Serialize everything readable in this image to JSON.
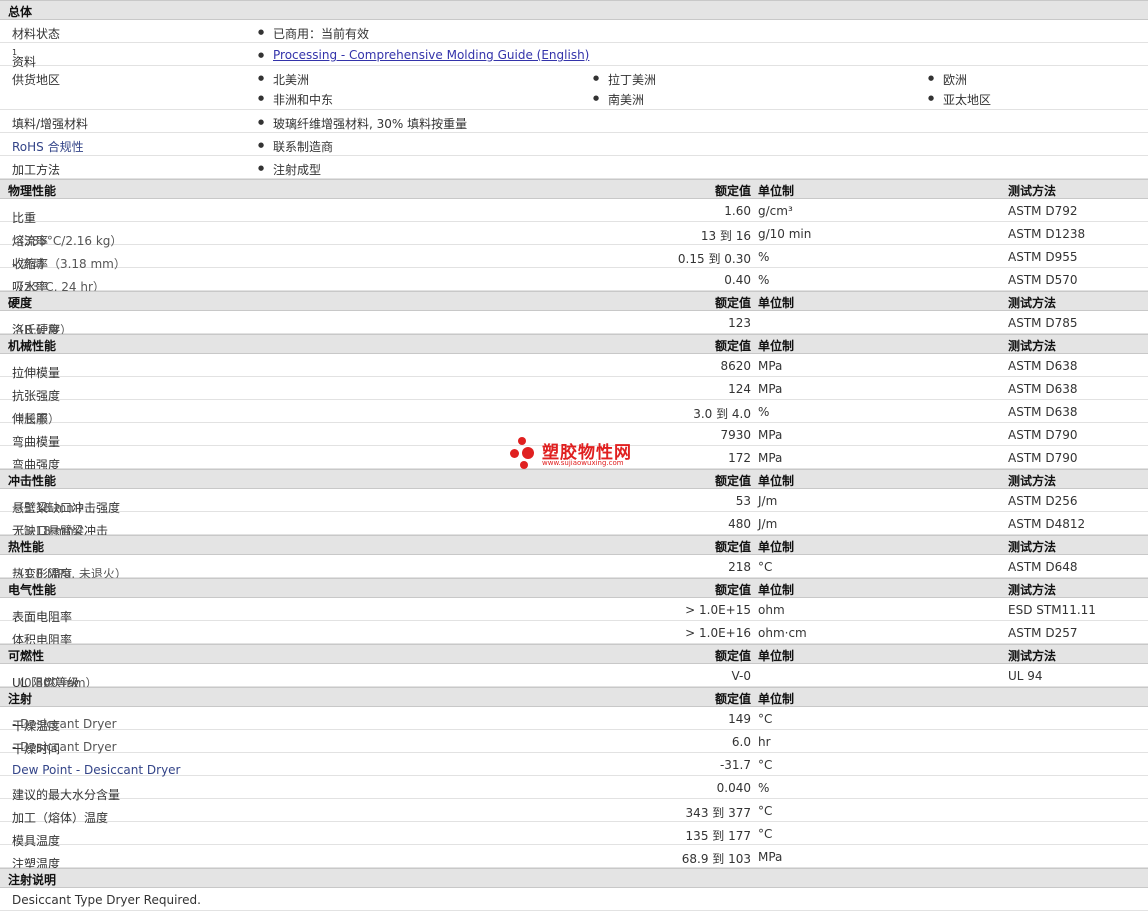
{
  "general": {
    "title": "总体",
    "status": {
      "label": "材料状态",
      "value": "已商用：当前有效"
    },
    "docs": {
      "label": "资料",
      "sup": "1",
      "link": "Processing - Comprehensive Molding Guide (English)"
    },
    "regions": {
      "label": "供货地区",
      "items": [
        "北美洲",
        "拉丁美洲",
        "欧洲",
        "非洲和中东",
        "南美洲",
        "亚太地区"
      ]
    },
    "filler": {
      "label": "填料/增强材料",
      "value": "玻璃纤维增强材料, 30% 填料按重量"
    },
    "rohs": {
      "label": "RoHS 合规性",
      "value": "联系制造商"
    },
    "process": {
      "label": "加工方法",
      "value": "注射成型"
    }
  },
  "headers": {
    "nominal": "额定值",
    "unit": "单位制",
    "method": "测试方法"
  },
  "sections": [
    {
      "title": "物理性能",
      "method_header": true,
      "rows": [
        {
          "label": "比重",
          "cond": "",
          "value": "1.60",
          "unit": "g/cm³",
          "method": "ASTM D792"
        },
        {
          "label": "熔流率",
          "cond": "（385°C/2.16 kg）",
          "value": "13 到   16",
          "unit": "g/10 min",
          "method": "ASTM D1238"
        },
        {
          "label": "收缩率",
          "cond": " - 流动 （3.18 mm）",
          "value": "0.15 到 0.30",
          "unit": "%",
          "method": "ASTM D955"
        },
        {
          "label": "吸水率",
          "cond": "（23°C, 24 hr）",
          "value": "0.40",
          "unit": "%",
          "method": "ASTM D570"
        }
      ]
    },
    {
      "title": "硬度",
      "method_header": true,
      "rows": [
        {
          "label": "洛氏硬度",
          "cond": "（R 计秤）",
          "value": "123",
          "unit": "",
          "method": "ASTM D785"
        }
      ]
    },
    {
      "title": "机械性能",
      "method_header": true,
      "rows": [
        {
          "label": "拉伸模量",
          "cond": "",
          "value": "8620",
          "unit": "MPa",
          "method": "ASTM D638"
        },
        {
          "label": "抗张强度",
          "cond": "",
          "value": "124",
          "unit": "MPa",
          "method": "ASTM D638"
        },
        {
          "label": "伸长率",
          "cond": "（屈服）",
          "value": "3.0 到  4.0",
          "unit": "%",
          "method": "ASTM D638"
        },
        {
          "label": "弯曲模量",
          "cond": "",
          "value": "7930",
          "unit": "MPa",
          "method": "ASTM D790"
        },
        {
          "label": "弯曲强度",
          "cond": "",
          "value": "172",
          "unit": "MPa",
          "method": "ASTM D790"
        }
      ]
    },
    {
      "title": "冲击性能",
      "method_header": true,
      "rows": [
        {
          "label": "悬壁梁缺口冲击强度",
          "cond": "（3.18 mm）",
          "value": "53",
          "unit": "J/m",
          "method": "ASTM D256"
        },
        {
          "label": "无缺口悬臂梁冲击",
          "cond": "（3.18 mm）",
          "value": "480",
          "unit": "J/m",
          "method": "ASTM D4812"
        }
      ]
    },
    {
      "title": "热性能",
      "method_header": true,
      "rows": [
        {
          "label": "热变形温度",
          "cond": "（1.8 MPa, 未退火）",
          "value": "218",
          "unit": "°C",
          "method": "ASTM D648"
        }
      ]
    },
    {
      "title": "电气性能",
      "method_header": true,
      "rows": [
        {
          "label": "表面电阻率",
          "cond": "",
          "value": "> 1.0E+15",
          "unit": "ohm",
          "method": "ESD STM11.11"
        },
        {
          "label": "体积电阻率",
          "cond": "",
          "value": "> 1.0E+16",
          "unit": "ohm·cm",
          "method": "ASTM D257"
        }
      ]
    },
    {
      "title": "可燃性",
      "method_header": true,
      "rows": [
        {
          "label": "UL 阻燃等级",
          "cond": "（0.800 mm）",
          "value": "V-0",
          "unit": "",
          "method": "UL 94"
        }
      ]
    },
    {
      "title": "注射",
      "method_header": false,
      "rows": [
        {
          "label": "干燥温度",
          "cond": " - Desiccant Dryer",
          "value": "149",
          "unit": "°C",
          "method": ""
        },
        {
          "label": "干燥时间",
          "cond": " - Desiccant Dryer",
          "value": "6.0",
          "unit": "hr",
          "method": ""
        },
        {
          "label": "Dew Point - Desiccant Dryer",
          "cond": "",
          "value": "-31.7",
          "unit": "°C",
          "method": ""
        },
        {
          "label": "建议的最大水分含量",
          "cond": "",
          "value": "0.040",
          "unit": "%",
          "method": ""
        },
        {
          "label": "加工（熔体）温度",
          "cond": "",
          "value": "343 到  377",
          "unit": "°C",
          "method": ""
        },
        {
          "label": "模具温度",
          "cond": "",
          "value": "135 到  177",
          "unit": "°C",
          "method": ""
        },
        {
          "label": "注塑温度",
          "cond": "",
          "value": "68.9 到  103",
          "unit": "MPa",
          "method": ""
        }
      ]
    }
  ],
  "notes": {
    "title": "注射说明",
    "text": "Desiccant Type Dryer Required."
  },
  "watermark": {
    "brand": "塑胶物性网",
    "url": "www.sujiaowuxing.com",
    "color": "#e02020"
  }
}
